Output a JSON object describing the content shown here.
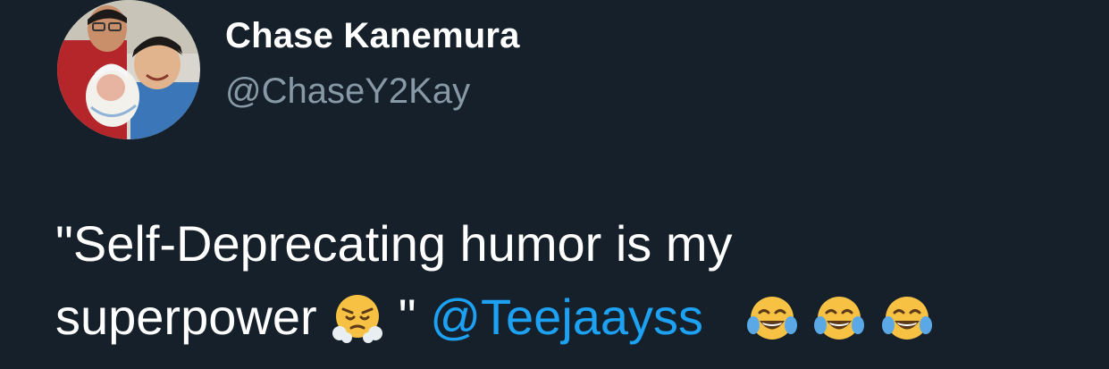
{
  "author": {
    "display_name": "Chase Kanemura",
    "handle": "@ChaseY2Kay",
    "avatar_icon": "family-photo-avatar"
  },
  "tweet": {
    "line1": "\"Self-Deprecating humor is my",
    "line2_before": "superpower",
    "quote_close": "\"",
    "mention": "@Teejaayss",
    "emoji_after_superpower": "face-with-steam-from-nose",
    "emoji_tail": [
      "face-with-tears-of-joy",
      "face-with-tears-of-joy",
      "face-with-tears-of-joy"
    ]
  },
  "colors": {
    "background": "#15202b",
    "text": "#ffffff",
    "handle": "#8899a6",
    "mention": "#1da1f2"
  }
}
